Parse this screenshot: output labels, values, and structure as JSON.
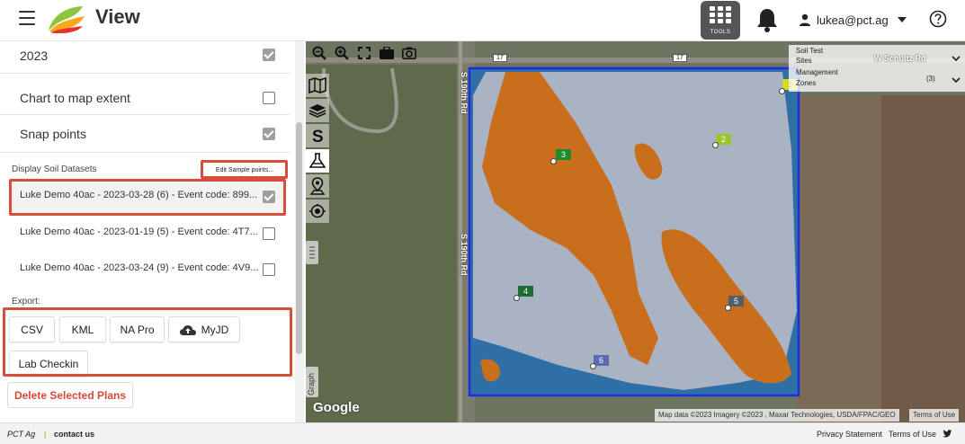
{
  "header": {
    "title": "View",
    "tools_label": "TOOLS",
    "user_email": "lukea@pct.ag"
  },
  "panel": {
    "rows": [
      {
        "label": "2023",
        "checked": true
      },
      {
        "label": "Chart to map extent",
        "checked": false
      },
      {
        "label": "Snap points",
        "checked": true
      }
    ],
    "display_soil_label": "Display Soil Datasets",
    "edit_sample_label": "Edit Sample points...",
    "datasets": [
      {
        "label": "Luke Demo 40ac - 2023-03-28 (6) - Event code: 899...",
        "checked": true,
        "selected": true
      },
      {
        "label": "Luke Demo 40ac - 2023-01-19 (5) - Event code: 4T7...",
        "checked": false,
        "selected": false
      },
      {
        "label": "Luke Demo 40ac - 2023-03-24 (9) - Event code: 4V9...",
        "checked": false,
        "selected": false
      }
    ],
    "export_label": "Export:",
    "export_buttons": {
      "csv": "CSV",
      "kml": "KML",
      "napro": "NA Pro",
      "myjd": "MyJD",
      "lab": "Lab Checkin"
    },
    "delete_label": "Delete Selected Plans"
  },
  "map": {
    "roads": {
      "top_route": "17",
      "top_route_2": "17",
      "vertical_1": "S 190th Rd",
      "vertical_2": "S 190th Rd",
      "east": "W Schultz Rd"
    },
    "legend": {
      "soil_test": "Soil Test",
      "sites": "Sites",
      "management": "Management",
      "zones": "Zones",
      "zones_count": "(3)"
    },
    "graph_label": "Graph",
    "google": "Google",
    "attribution": "Map data ©2023 Imagery ©2023 , Maxar Technologies, USDA/FPAC/GEO",
    "terms": "Terms of Use",
    "markers": [
      {
        "label": "1",
        "color": "#d8d820"
      },
      {
        "label": "2",
        "color": "#9cc52a"
      },
      {
        "label": "3",
        "color": "#1f8a2c"
      },
      {
        "label": "4",
        "color": "#1d6b35"
      },
      {
        "label": "5",
        "color": "#4f5f6b"
      },
      {
        "label": "6",
        "color": "#5a6bb0"
      }
    ],
    "colors": {
      "zone_high": "#c86e1c",
      "zone_mid": "#a9b3c3",
      "zone_low": "#2f6fa5",
      "boundary": "#1d2fe0"
    }
  },
  "footer": {
    "brand": "PCT Ag",
    "separator": "|",
    "contact": "contact us",
    "privacy": "Privacy Statement",
    "terms": "Terms of Use"
  }
}
